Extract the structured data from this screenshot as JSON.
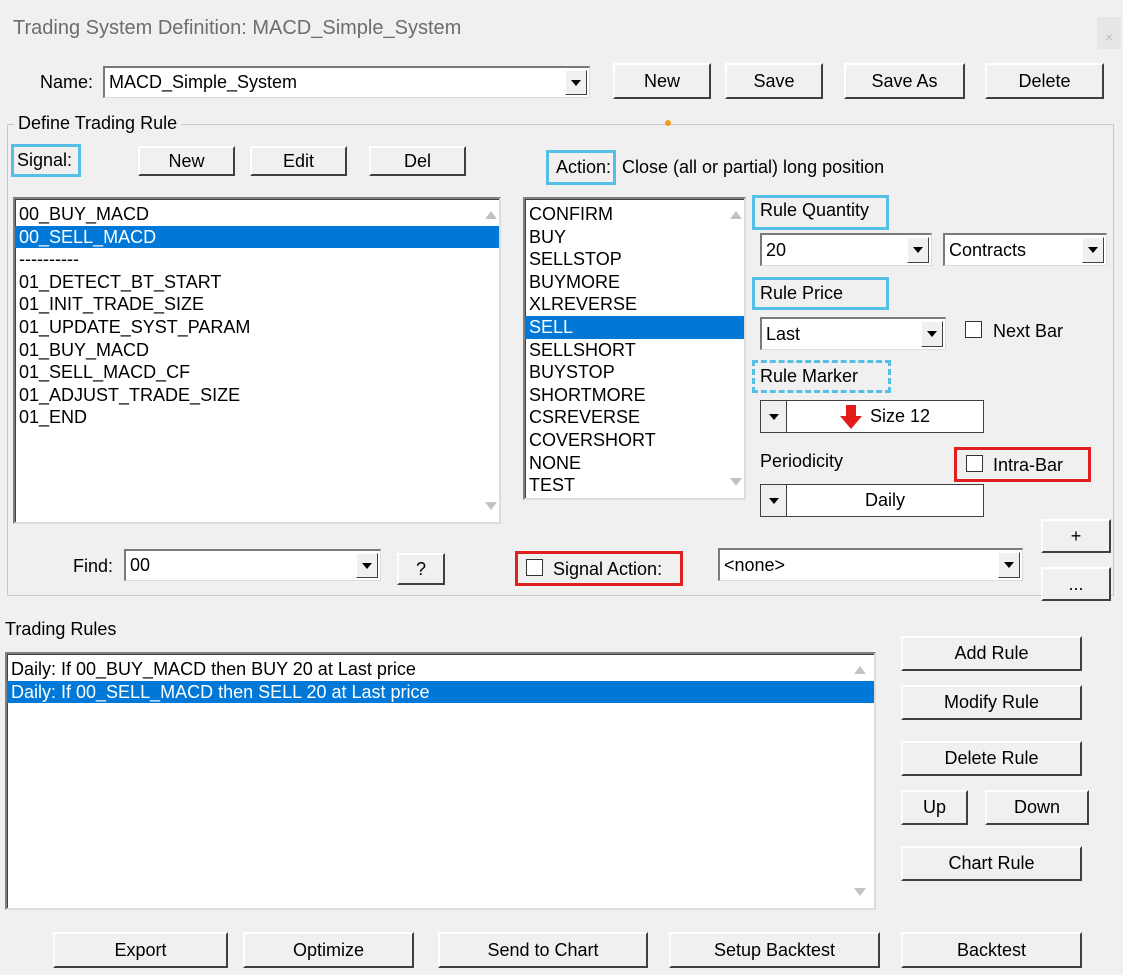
{
  "window": {
    "title": "Trading System Definition:  MACD_Simple_System",
    "close_glyph": "×"
  },
  "name_row": {
    "label": "Name:",
    "value": "MACD_Simple_System",
    "new_label": "New",
    "save_label": "Save",
    "save_as_label": "Save As",
    "delete_label": "Delete"
  },
  "define_rule": {
    "group_label": "Define Trading Rule",
    "signal_label": "Signal:",
    "signal_new": "New",
    "signal_edit": "Edit",
    "signal_del": "Del",
    "action_label": "Action:",
    "action_text": "Close (all or partial) long position",
    "signals": [
      "00_BUY_MACD",
      "00_SELL_MACD",
      "----------",
      "01_DETECT_BT_START",
      "01_INIT_TRADE_SIZE",
      "01_UPDATE_SYST_PARAM",
      "01_BUY_MACD",
      "01_SELL_MACD_CF",
      "01_ADJUST_TRADE_SIZE",
      "01_END"
    ],
    "actions": [
      "CONFIRM",
      "BUY",
      "SELLSTOP",
      "BUYMORE",
      "XLREVERSE",
      "SELL",
      "SELLSHORT",
      "BUYSTOP",
      "SHORTMORE",
      "CSREVERSE",
      "COVERSHORT",
      "NONE",
      "TEST"
    ],
    "rule_quantity_label": "Rule Quantity",
    "quantity_value": "20",
    "quantity_unit": "Contracts",
    "rule_price_label": "Rule Price",
    "price_value": "Last",
    "next_bar_label": "Next Bar",
    "rule_marker_label": "Rule Marker",
    "marker_text": "Size 12",
    "marker_color": "#e31b1b",
    "periodicity_label": "Periodicity",
    "periodicity_value": "Daily",
    "intra_bar_label": "Intra-Bar",
    "find_label": "Find:",
    "find_value": "00",
    "help_label": "?",
    "signal_action_label": "Signal Action:",
    "signal_action_value": "<none>",
    "plus_label": "+",
    "more_label": "..."
  },
  "trading_rules": {
    "label": "Trading Rules",
    "rules": [
      "Daily: If 00_BUY_MACD then BUY 20 at Last price",
      "Daily: If 00_SELL_MACD then SELL 20 at Last price"
    ],
    "add_rule": "Add Rule",
    "modify_rule": "Modify Rule",
    "delete_rule": "Delete Rule",
    "up": "Up",
    "down": "Down",
    "chart_rule": "Chart Rule"
  },
  "bottom_buttons": {
    "export": "Export",
    "optimize": "Optimize",
    "send_to_chart": "Send to Chart",
    "setup_backtest": "Setup Backtest",
    "backtest": "Backtest"
  },
  "colors": {
    "selection": "#0078d7",
    "highlight_blue": "#56bfe6",
    "highlight_red": "#e01f1f",
    "dialog_bg": "#f0f0f0"
  }
}
